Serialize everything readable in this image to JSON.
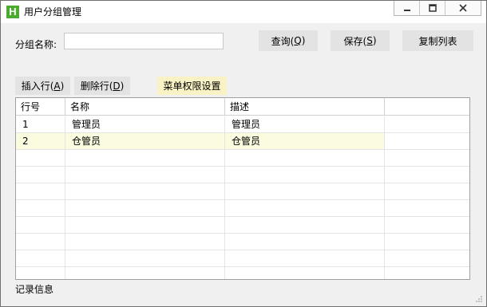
{
  "window": {
    "icon_letter": "H",
    "title": "用户分组管理"
  },
  "search": {
    "label": "分组名称:",
    "value": "",
    "placeholder": ""
  },
  "toolbar": {
    "query": {
      "text": "查询(",
      "key": "Q",
      "end": ")"
    },
    "save": {
      "text": "保存(",
      "key": "S",
      "end": ")"
    },
    "copy_label": "复制列表"
  },
  "row_actions": {
    "insert": {
      "text": "插入行(",
      "key": "A",
      "end": ")"
    },
    "delete": {
      "text": "删除行(",
      "key": "D",
      "end": ")"
    },
    "menu_label": "菜单权限设置"
  },
  "grid": {
    "columns": [
      "行号",
      "名称",
      "描述",
      ""
    ],
    "rows": [
      {
        "no": "1",
        "name": "管理员",
        "desc": "管理员"
      },
      {
        "no": "2",
        "name": "仓管员",
        "desc": "仓管员"
      }
    ],
    "selected_row": 2
  },
  "status": {
    "text": "记录信息"
  }
}
